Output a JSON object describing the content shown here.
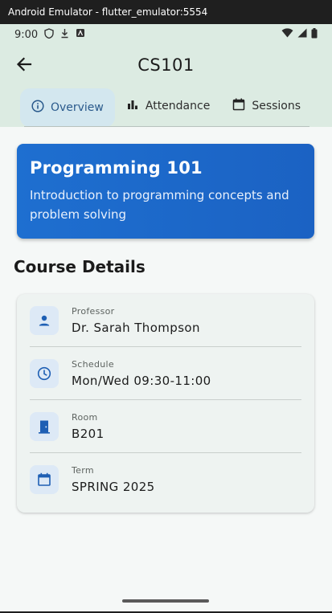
{
  "window": {
    "title": "Android Emulator - flutter_emulator:5554"
  },
  "status_bar": {
    "time": "9:00"
  },
  "app_bar": {
    "title": "CS101"
  },
  "tabs": [
    {
      "label": "Overview",
      "icon": "info-icon",
      "active": true
    },
    {
      "label": "Attendance",
      "icon": "bar-chart-icon",
      "active": false
    },
    {
      "label": "Sessions",
      "icon": "calendar-icon",
      "active": false
    }
  ],
  "hero": {
    "title": "Programming 101",
    "description": "Introduction to programming concepts and problem solving"
  },
  "section": {
    "title": "Course Details"
  },
  "details": [
    {
      "label": "Professor",
      "value": "Dr. Sarah Thompson",
      "icon": "person-icon"
    },
    {
      "label": "Schedule",
      "value": "Mon/Wed 09:30-11:00",
      "icon": "clock-icon"
    },
    {
      "label": "Room",
      "value": "B201",
      "icon": "door-icon"
    },
    {
      "label": "Term",
      "value": "SPRING 2025",
      "icon": "calendar-icon"
    }
  ],
  "colors": {
    "accent": "#1e6fd0",
    "header_bg": "#dcebe2",
    "active_tab_bg": "#d3e7ef",
    "active_tab_text": "#2a5a8c"
  }
}
